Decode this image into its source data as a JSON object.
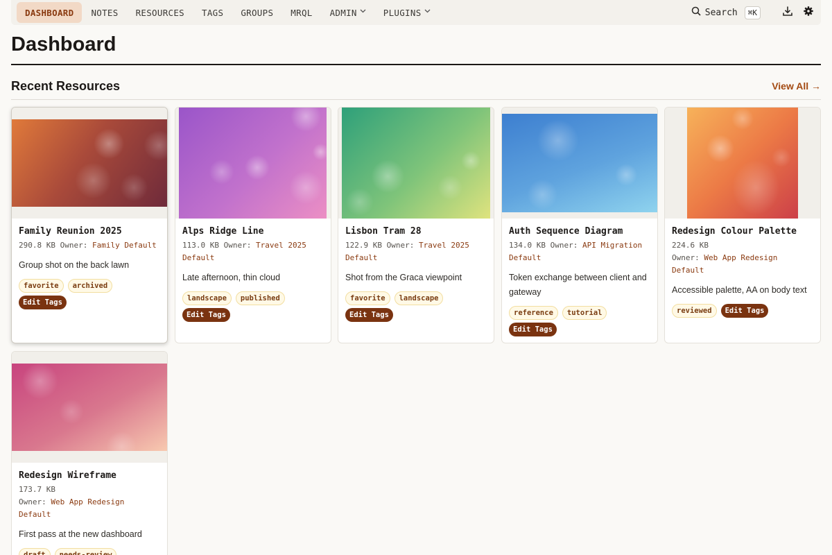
{
  "nav": {
    "items": [
      {
        "label": "DASHBOARD"
      },
      {
        "label": "NOTES"
      },
      {
        "label": "RESOURCES"
      },
      {
        "label": "TAGS"
      },
      {
        "label": "GROUPS"
      },
      {
        "label": "MRQL"
      },
      {
        "label": "ADMIN"
      },
      {
        "label": "PLUGINS"
      }
    ],
    "search_label": "Search",
    "search_shortcut": "⌘K"
  },
  "page_title": "Dashboard",
  "section": {
    "title": "Recent Resources",
    "view_all": "View All →"
  },
  "edit_tags_label": "Edit Tags",
  "owner_label": "Owner:",
  "resources": [
    {
      "name": "Family Reunion 2025",
      "size": "290.8 KB",
      "owner": "Family Default",
      "description": "Group shot on the back lawn",
      "tags": [
        "favorite",
        "archived"
      ]
    },
    {
      "name": "Alps Ridge Line",
      "size": "113.0 KB",
      "owner": "Travel 2025 Default",
      "description": "Late afternoon, thin cloud",
      "tags": [
        "landscape",
        "published"
      ]
    },
    {
      "name": "Lisbon Tram 28",
      "size": "122.9 KB",
      "owner": "Travel 2025 Default",
      "description": "Shot from the Graca viewpoint",
      "tags": [
        "favorite",
        "landscape"
      ]
    },
    {
      "name": "Auth Sequence Diagram",
      "size": "134.0 KB",
      "owner": "API Migration Default",
      "description": "Token exchange between client and gateway",
      "tags": [
        "reference",
        "tutorial"
      ]
    },
    {
      "name": "Redesign Colour Palette",
      "size": "224.6 KB",
      "owner": "Web App Redesign Default",
      "description": "Accessible palette, AA on body text",
      "tags": [
        "reviewed"
      ]
    },
    {
      "name": "Redesign Wireframe",
      "size": "173.7 KB",
      "owner": "Web App Redesign Default",
      "description": "First pass at the new dashboard",
      "tags": [
        "draft",
        "needs-review"
      ]
    }
  ],
  "colors": {
    "accent": "#a34a12",
    "nav_active_bg": "#f2d9c6",
    "edit_tags_bg": "#7a3310",
    "tag_bg": "#fff9e6"
  }
}
